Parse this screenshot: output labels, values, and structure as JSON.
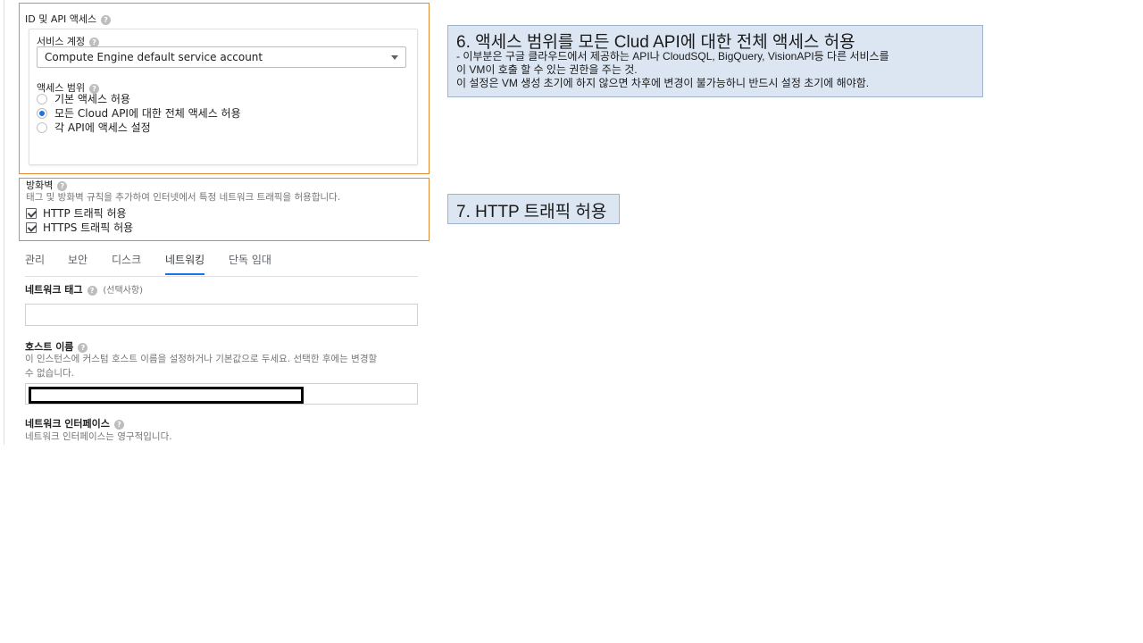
{
  "identity_api": {
    "title": "ID 및 API 액세스",
    "service_account": {
      "label": "서비스 계정",
      "value": "Compute Engine default service account"
    },
    "access_scope": {
      "label": "액세스 범위",
      "options": [
        {
          "label": "기본 액세스 허용",
          "selected": false
        },
        {
          "label": "모든 Cloud API에 대한 전체 액세스 허용",
          "selected": true
        },
        {
          "label": "각 API에 액세스 설정",
          "selected": false
        }
      ]
    }
  },
  "firewall": {
    "title": "방화벽",
    "description": "태그 및 방화벽 규칙을 추가하여 인터넷에서 특정 네트워크 트래픽을 허용합니다.",
    "options": [
      {
        "label": "HTTP 트래픽 허용",
        "checked": true
      },
      {
        "label": "HTTPS 트래픽 허용",
        "checked": true
      }
    ]
  },
  "tabs": [
    "관리",
    "보안",
    "디스크",
    "네트워킹",
    "단독 임대"
  ],
  "active_tab": "네트워킹",
  "network_tags": {
    "label": "네트워크 태그",
    "optional": "(선택사항)",
    "value": ""
  },
  "hostname": {
    "label": "호스트 이름",
    "description_line1": "이 인스턴스에 커스텀 호스트 이름을 설정하거나 기본값으로 두세요. 선택한 후에는 변경할",
    "description_line2": "수 없습니다."
  },
  "network_interface": {
    "label": "네트워크 인터페이스",
    "description": "네트워크 인터페이스는 영구적입니다."
  },
  "notes": {
    "note6": {
      "title": "6. 액세스 범위를 모든 Clud API에 대한 전체 액세스 허용",
      "line1": "- 이부분은 구글 클라우드에서 제공하는 API나 CloudSQL, BigQuery, VisionAPI등 다른 서비스를",
      "line2": "이 VM이 호출 할 수 있는 권한을 주는 것.",
      "line3": "이 설정은 VM 생성 초기에 하지 않으면 차후에 변경이 불가능하니 반드시 설정 초기에 해야함."
    },
    "note7": {
      "title": "7. HTTP 트래픽 허용"
    }
  },
  "colors": {
    "highlight_border": "#e08b3a",
    "note_background": "#dce6f2",
    "accent": "#1a73e8"
  }
}
